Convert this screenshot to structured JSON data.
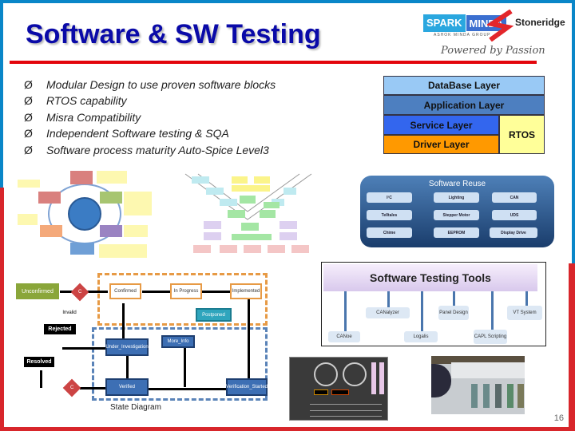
{
  "title": "Software & SW Testing",
  "bullets": [
    "Modular Design to use proven software blocks",
    "RTOS capability",
    "Misra Compatibility",
    "Independent Software testing & SQA",
    "Software process maturity Auto-Spice Level3"
  ],
  "bullet_glyph": "Ø",
  "logo": {
    "spark": "SPARK",
    "minda": "MINDA",
    "group": "ASHOK MINDA GROUP",
    "stoneridge": "Stoneridge",
    "signature": "Powered by Passion"
  },
  "layers": {
    "database": "DataBase Layer",
    "application": "Application Layer",
    "service": "Service Layer",
    "driver": "Driver Layer",
    "rtos": "RTOS"
  },
  "reuse": {
    "title": "Software Reuse",
    "items": [
      "I²C",
      "Lighting",
      "CAN",
      "Telltales",
      "Stepper Motor",
      "UDS",
      "Chime",
      "EEPROM",
      "Display Drive"
    ]
  },
  "tools": {
    "title": "Software Testing Tools",
    "items": [
      "CANoe",
      "CANalyzer",
      "Logalis",
      "Panel Design",
      "CAPL Scripting",
      "VT System"
    ]
  },
  "state": {
    "caption": "State Diagram",
    "unconfirmed": "Unconfirmed",
    "c": "C",
    "invalid": "Invalid",
    "rejected": "Rejected",
    "resolved": "Resolved",
    "confirmed": "Confirmed",
    "in_progress": "In Progress",
    "implemented": "Implemented",
    "postponed": "Postponed",
    "under_investigation": "Under_Investigation",
    "more_info": "More_Info",
    "verified": "Verified",
    "verification_started": "Verification_Started"
  },
  "colors": {
    "title": "#0a0aa8",
    "rule": "#e3060d",
    "database": "#99c9f5",
    "application": "#4d7fc0",
    "service": "#3366ee",
    "driver": "#ff9900",
    "rtos": "#ffff99"
  },
  "page_number": "16"
}
